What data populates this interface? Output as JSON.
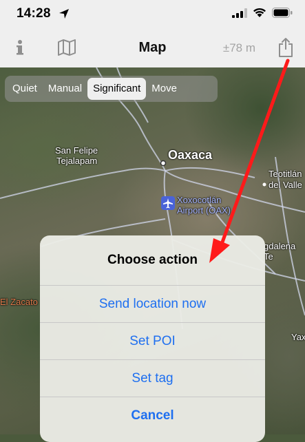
{
  "status_bar": {
    "time": "14:28"
  },
  "navbar": {
    "title": "Map",
    "accuracy": "±78 m",
    "icons": [
      "info-icon",
      "map-icon",
      "share-icon"
    ]
  },
  "modes": {
    "items": [
      "Quiet",
      "Manual",
      "Significant",
      "Move"
    ],
    "selected": "Significant"
  },
  "map_labels": {
    "oaxaca": "Oaxaca",
    "san_felipe_1": "San Felipe",
    "san_felipe_2": "Tejalapam",
    "xoxocotlan_1": "Xoxocotlán",
    "xoxocotlan_2": "Airport (OAX)",
    "teotitlan_1": "Teotitlán",
    "teotitlan_2": "del Valle",
    "magdalena": "gdalena Te",
    "zacato": "El Zacato",
    "yax": "Yax"
  },
  "action_sheet": {
    "title": "Choose action",
    "actions": [
      "Send location now",
      "Set POI",
      "Set tag"
    ],
    "cancel": "Cancel"
  },
  "colors": {
    "accent": "#1e6ff0",
    "arrow": "#ff1a1a"
  }
}
